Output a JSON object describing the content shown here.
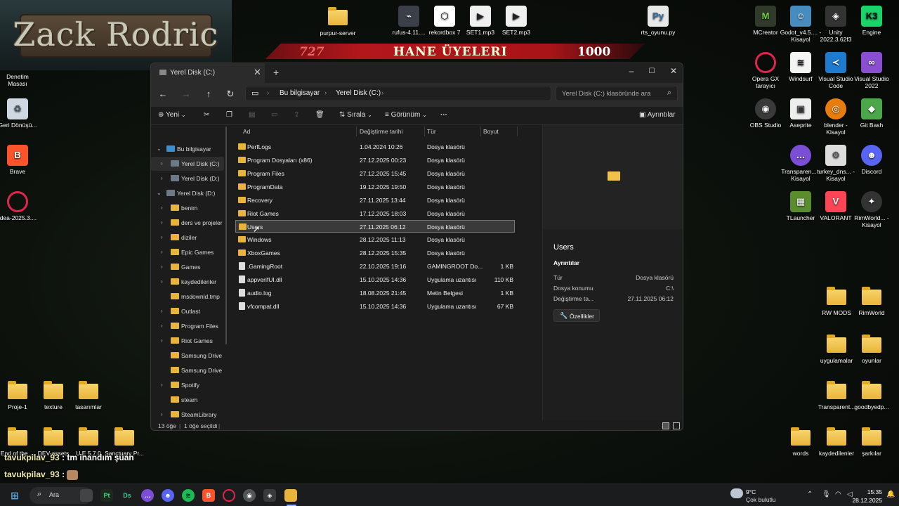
{
  "banner": {
    "title": "Zack Rodric"
  },
  "stream_bar": {
    "left_number": "727",
    "title": "HANE ÜYELERI",
    "right_number": "1000"
  },
  "desktop_icons": {
    "top": [
      "purpur-server",
      "rufus-4.11....",
      "rekordbox 7",
      "SET1.mp3",
      "SET2.mp3",
      "rts_oyunu.py"
    ],
    "left": [
      "Denetim Masası",
      "Geri Dönüşü...",
      "Brave",
      "idea-2025.3...."
    ],
    "right_col1": [
      "MCreator",
      "Opera GX tarayıcı",
      "OBS Studio",
      "Transparen... - Kisayol",
      "TLauncher"
    ],
    "right_col2": [
      "Godot_v4.5.... - Kisayol",
      "Windsurf",
      "Aseprite",
      "turkey_dns... - Kisayol",
      "VALORANT"
    ],
    "right_col3": [
      "Unity 2022.3.62f3",
      "Visual Studio Code",
      "blender - Kisayol"
    ],
    "right_col4": [
      "Engine",
      "Visual Studio 2022",
      "Git Bash",
      "Discord",
      "RimWorld... - Kisayol"
    ],
    "right_folders": [
      "RW MODS",
      "RimWorld",
      "uygulamalar",
      "oyunlar",
      "Transparent...",
      "goodbyedp...",
      "words",
      "kaydedilenler",
      "şarkılar"
    ],
    "bottom_left": [
      "Proje-1",
      "texture",
      "tasarımlar",
      "End of the ...",
      "DEV-assets",
      "U.E 5.7.0",
      "Sanctuary Pr..."
    ]
  },
  "window": {
    "tab_title": "Yerel Disk (C:)",
    "breadcrumb": [
      "Bu bilgisayar",
      "Yerel Disk (C:)"
    ],
    "search_placeholder": "Yerel Disk (C:) klasöründe ara",
    "toolbar": {
      "new": "Yeni",
      "sort": "Sırala",
      "view": "Görünüm",
      "details": "Ayrıntılar"
    },
    "sidebar": [
      {
        "label": "Bu bilgisayar",
        "expanded": true
      },
      {
        "label": "Yerel Disk (C:)",
        "selected": true
      },
      {
        "label": "Yerel Disk (D:)"
      },
      {
        "label": "Yerel Disk (D:)",
        "expanded": true
      },
      {
        "label": "benim"
      },
      {
        "label": "ders ve projeler"
      },
      {
        "label": "diziler"
      },
      {
        "label": "Epic Games"
      },
      {
        "label": "Games"
      },
      {
        "label": "kaydedilenler"
      },
      {
        "label": "msdownld.tmp"
      },
      {
        "label": "Outlast"
      },
      {
        "label": "Program Files"
      },
      {
        "label": "Riot Games"
      },
      {
        "label": "Samsung Drive"
      },
      {
        "label": "Samsung Drive"
      },
      {
        "label": "Spotify"
      },
      {
        "label": "steam"
      },
      {
        "label": "SteamLibrary"
      }
    ],
    "columns": [
      "Ad",
      "Değiştirme tarihi",
      "Tür",
      "Boyut"
    ],
    "files": [
      {
        "name": "PerfLogs",
        "date": "1.04.2024 10:26",
        "type": "Dosya klasörü",
        "size": "",
        "kind": "folder"
      },
      {
        "name": "Program Dosyaları (x86)",
        "date": "27.12.2025 00:23",
        "type": "Dosya klasörü",
        "size": "",
        "kind": "folder"
      },
      {
        "name": "Program Files",
        "date": "27.12.2025 15:45",
        "type": "Dosya klasörü",
        "size": "",
        "kind": "folder"
      },
      {
        "name": "ProgramData",
        "date": "19.12.2025 19:50",
        "type": "Dosya klasörü",
        "size": "",
        "kind": "folder"
      },
      {
        "name": "Recovery",
        "date": "27.11.2025 13:44",
        "type": "Dosya klasörü",
        "size": "",
        "kind": "folder"
      },
      {
        "name": "Riot Games",
        "date": "17.12.2025 18:03",
        "type": "Dosya klasörü",
        "size": "",
        "kind": "folder"
      },
      {
        "name": "Users",
        "date": "27.11.2025 06:12",
        "type": "Dosya klasörü",
        "size": "",
        "kind": "folder",
        "selected": true
      },
      {
        "name": "Windows",
        "date": "28.12.2025 11:13",
        "type": "Dosya klasörü",
        "size": "",
        "kind": "folder"
      },
      {
        "name": "XboxGames",
        "date": "28.12.2025 15:35",
        "type": "Dosya klasörü",
        "size": "",
        "kind": "folder"
      },
      {
        "name": ".GamingRoot",
        "date": "22.10.2025 19:16",
        "type": "GAMINGROOT Do...",
        "size": "1 KB",
        "kind": "file"
      },
      {
        "name": "appverifUI.dll",
        "date": "15.10.2025 14:36",
        "type": "Uygulama uzantısı",
        "size": "110 KB",
        "kind": "file"
      },
      {
        "name": "audio.log",
        "date": "18.08.2025 21:45",
        "type": "Metin Belgesi",
        "size": "1 KB",
        "kind": "file"
      },
      {
        "name": "vfcompat.dll",
        "date": "15.10.2025 14:36",
        "type": "Uygulama uzantısı",
        "size": "67 KB",
        "kind": "file"
      }
    ],
    "preview": {
      "title": "Users",
      "section": "Ayrıntılar",
      "props": [
        {
          "k": "Tür",
          "v": "Dosya klasörü"
        },
        {
          "k": "Dosya konumu",
          "v": "C:\\"
        },
        {
          "k": "Değiştirme ta...",
          "v": "27.11.2025 06:12"
        }
      ],
      "button": "Özellikler"
    },
    "status": {
      "count": "13 öğe",
      "selected": "1 öğe seçildi"
    }
  },
  "chat": [
    {
      "user": "tavukpilav_93",
      "msg": ": tm inandım şuan"
    },
    {
      "user": "tavukpilav_93",
      "msg": ":"
    }
  ],
  "taskbar": {
    "search": "Ara",
    "weather_temp": "9°C",
    "weather_desc": "Çok bulutlu",
    "time": "15:35",
    "date": "28.12.2025"
  }
}
